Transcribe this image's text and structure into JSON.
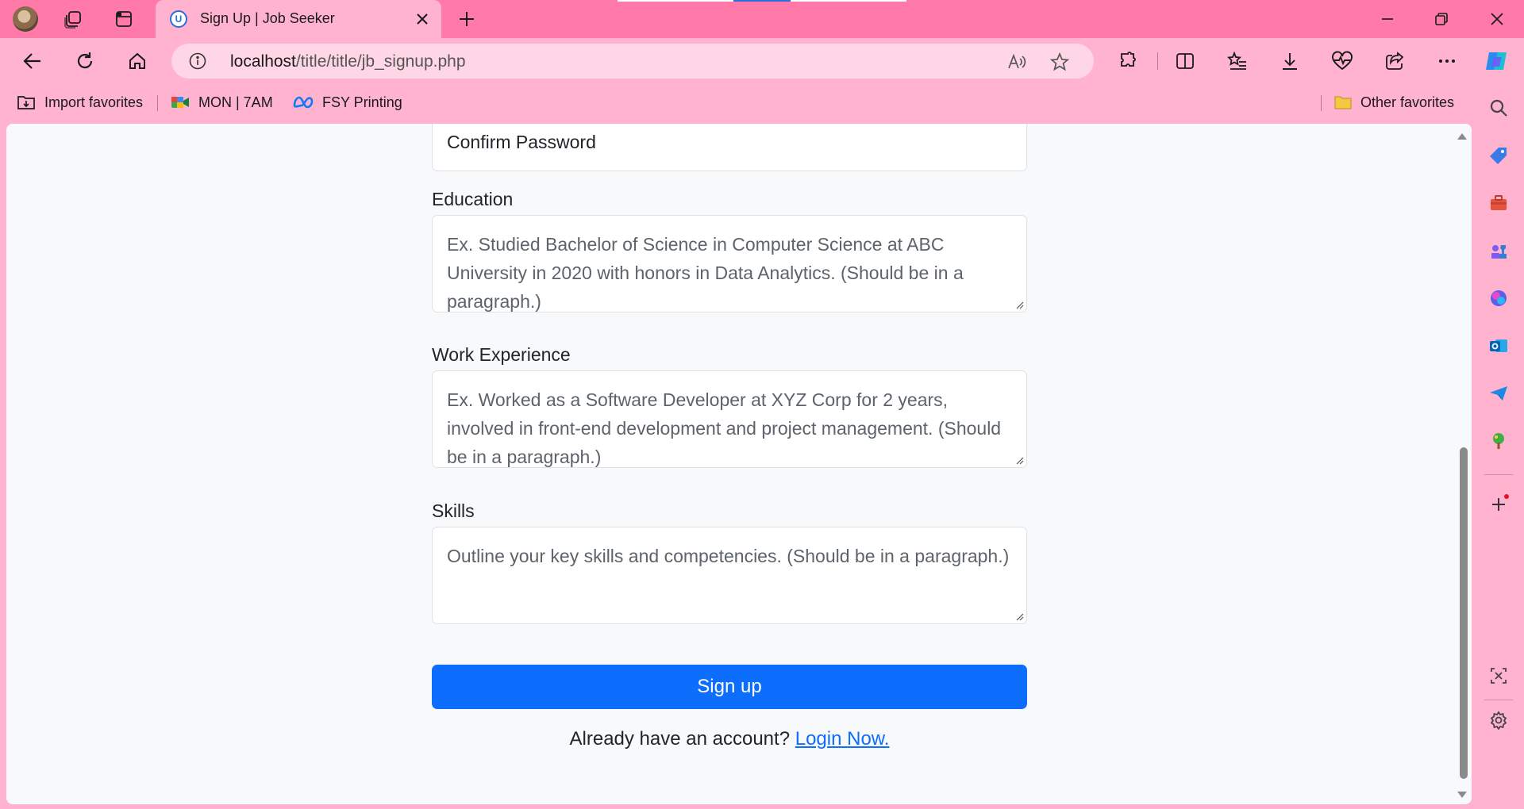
{
  "browser": {
    "tab": {
      "title": "Sign Up | Job Seeker"
    },
    "address": {
      "host": "localhost",
      "path": "/title/title/jb_signup.php"
    },
    "favorites": [
      {
        "label": "Import favorites",
        "icon": "import-favorites-icon"
      },
      {
        "label": "MON | 7AM",
        "icon": "google-meet-icon"
      },
      {
        "label": "FSY Printing",
        "icon": "meta-icon"
      }
    ],
    "other_favorites": "Other favorites",
    "colors": {
      "frame": "#ff7aa8",
      "toolbar": "#ffb3cf",
      "address": "#ffd6e5"
    }
  },
  "form": {
    "confirm_password_placeholder": "Confirm Password",
    "education": {
      "label": "Education",
      "placeholder": "Ex. Studied Bachelor of Science in Computer Science at ABC University in 2020 with honors in Data Analytics. (Should be in a paragraph.)"
    },
    "work_experience": {
      "label": "Work Experience",
      "placeholder": "Ex. Worked as a Software Developer at XYZ Corp for 2 years, involved in front-end development and project management. (Should be in a paragraph.)"
    },
    "skills": {
      "label": "Skills",
      "placeholder": "Outline your key skills and competencies. (Should be in a paragraph.)"
    },
    "submit_label": "Sign up",
    "login_prompt": "Already have an account?",
    "login_link": "Login Now.",
    "colors": {
      "primary": "#0d6efd",
      "page_bg": "#f8f9fa"
    }
  }
}
